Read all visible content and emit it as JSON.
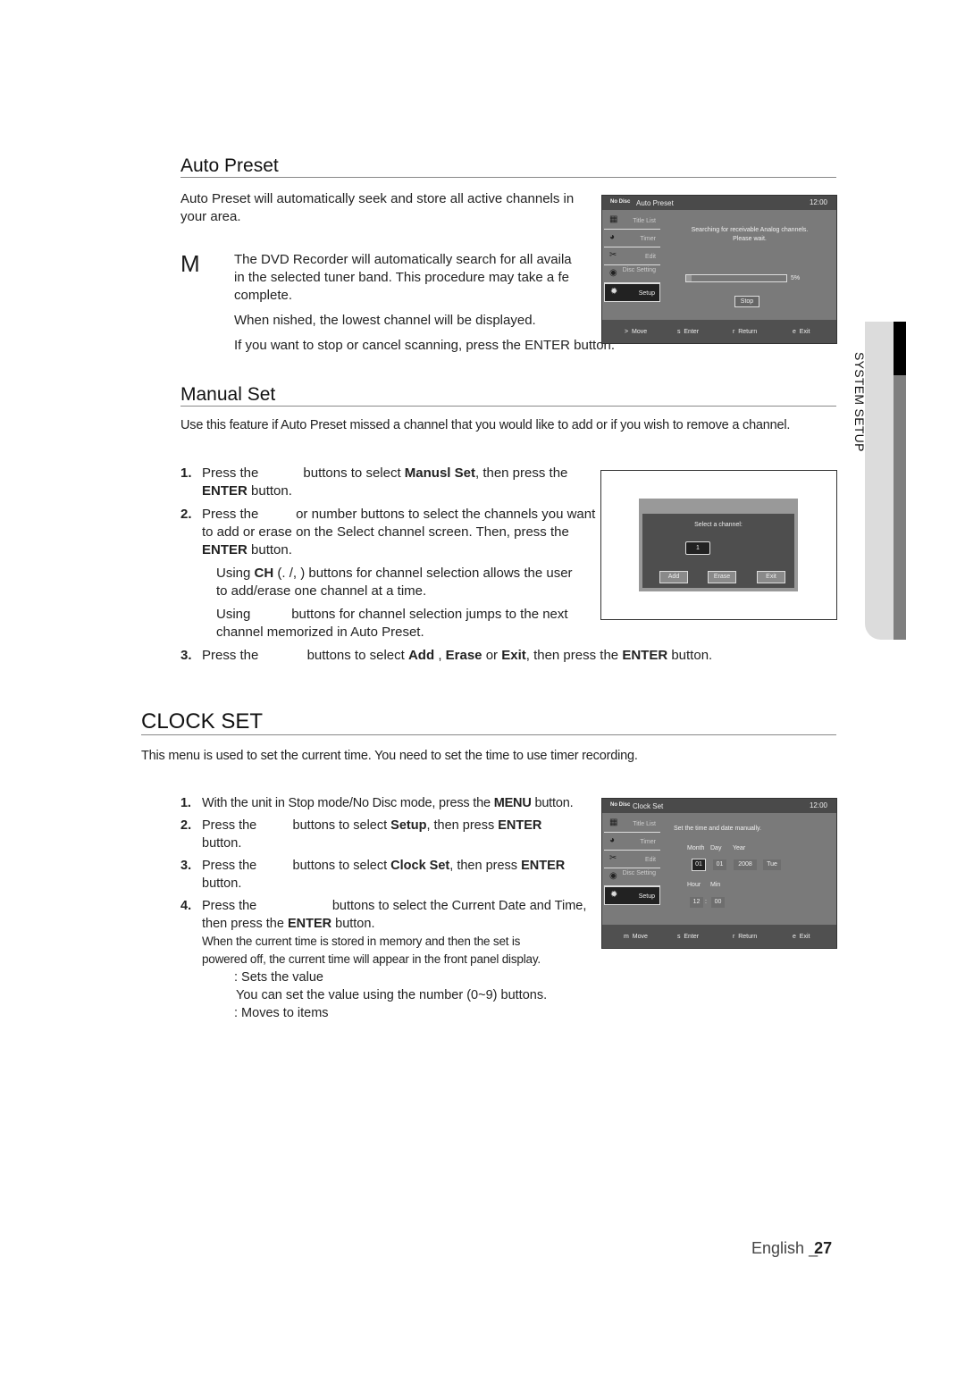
{
  "auto_preset": {
    "heading": "Auto Preset",
    "intro_line1": "Auto Preset will automatically seek and store all active channels in",
    "intro_line2": "your area.",
    "note_marker": "M",
    "note_line1": "The DVD Recorder will automatically search for all availa",
    "note_line2": "in the selected tuner band. This procedure may take a fe",
    "note_line3": "complete.",
    "note_line4": "When  nished, the lowest channel will be displayed.",
    "note_line5": "If you want to stop or cancel scanning, press the ENTER button.",
    "osd": {
      "no_disc": "No Disc",
      "title": "Auto Preset",
      "time": "12:00",
      "message_line1": "Searching for receivable Analog channels.",
      "message_line2": "Please wait.",
      "progress_percent": 5,
      "progress_label": "5%",
      "stop_button": "Stop"
    }
  },
  "osd_menu": [
    {
      "label": "Title List",
      "icon": "film-icon"
    },
    {
      "label": "Timer",
      "icon": "clock-icon"
    },
    {
      "label": "Edit",
      "icon": "scissors-icon"
    },
    {
      "label": "Disc Setting",
      "icon": "disc-icon"
    },
    {
      "label": "Setup",
      "icon": "gear-icon",
      "selected": true
    }
  ],
  "osd_footer": {
    "move_key_auto": ">",
    "move_key_clock": "m",
    "move": "Move",
    "enter_key": "s",
    "enter": "Enter",
    "return_key": "r",
    "return": "Return",
    "exit_key": "e",
    "exit": "Exit"
  },
  "manual_set": {
    "heading": "Manual Set",
    "intro": "Use this feature if Auto Preset missed a channel that you would like to add or if you wish to remove a channel.",
    "step1_num": "1.",
    "step1_a": "Press the",
    "step1_b": "buttons to select",
    "step1_bold": "Manusl Set",
    "step1_c": ", then press the",
    "step1_enter": "ENTER",
    "step1_d": "button.",
    "step2_num": "2.",
    "step2_a": "Press the",
    "step2_b": "or number buttons to select the channels you want",
    "step2_line2": "to add or erase on the Select channel screen. Then, press the",
    "step2_enter": "ENTER",
    "step2_d": "button.",
    "sub1_a": "Using",
    "sub1_bold": "CH",
    "sub1_b": "(.   /,   ) buttons for channel selection allows the user",
    "sub1_line2": "to add/erase one channel at a time.",
    "sub2_a": "Using",
    "sub2_b": "buttons for channel selection jumps to the next",
    "sub2_line2": "channel memorized in Auto Preset.",
    "step3_num": "3.",
    "step3_a": "Press the",
    "step3_b": "buttons to select",
    "step3_add": "Add",
    "step3_c": ",",
    "step3_erase": "Erase",
    "step3_d": "or",
    "step3_exit": "Exit",
    "step3_e": ", then press the",
    "step3_enter": "ENTER",
    "step3_f": "button.",
    "dialog": {
      "prompt": "Select a channel:",
      "channel": "1",
      "add": "Add",
      "erase": "Erase",
      "exit": "Exit"
    }
  },
  "clock_set": {
    "heading": "CLOCK SET",
    "intro": "This menu is used to set the current time. You need to set the time to use timer recording.",
    "step1_num": "1.",
    "step1_a": "With the unit in Stop mode/No Disc mode, press the",
    "step1_bold": "MENU",
    "step1_b": "button.",
    "step2_num": "2.",
    "step2_a": "Press the",
    "step2_b": "buttons to select",
    "step2_bold": "Setup",
    "step2_c": ", then press",
    "step2_enter": "ENTER",
    "step2_line2": "button.",
    "step3_num": "3.",
    "step3_a": "Press the",
    "step3_b": "buttons to select",
    "step3_bold": "Clock Set",
    "step3_c": ", then press",
    "step3_enter": "ENTER",
    "step3_line2": "button.",
    "step4_num": "4.",
    "step4_a": "Press the",
    "step4_b": "buttons to select the Current Date and Time,",
    "step4_line2a": "then press the",
    "step4_enter": "ENTER",
    "step4_line2b": "button.",
    "note_line1": "When the current time is stored in memory and then the set is",
    "note_line2": "powered off, the current time will appear in the front panel display.",
    "key1": ": Sets the value",
    "key1_sub": "You can set the value using the number (0~9) buttons.",
    "key2": ": Moves to items",
    "osd": {
      "no_disc": "No Disc",
      "title": "Clock Set",
      "time": "12:00",
      "message": "Set the time and date manually.",
      "month_label": "Month",
      "day_label": "Day",
      "year_label": "Year",
      "month": "01",
      "day": "01",
      "year": "2008",
      "weekday": "Tue",
      "hour_label": "Hour",
      "min_label": "Min",
      "hour": "12",
      "sep": ":",
      "min": "00"
    }
  },
  "side_tab": {
    "label": "SYSTEM SETUP"
  },
  "footer": {
    "language": "English",
    "page_prefix": "_",
    "page_number": "27"
  }
}
